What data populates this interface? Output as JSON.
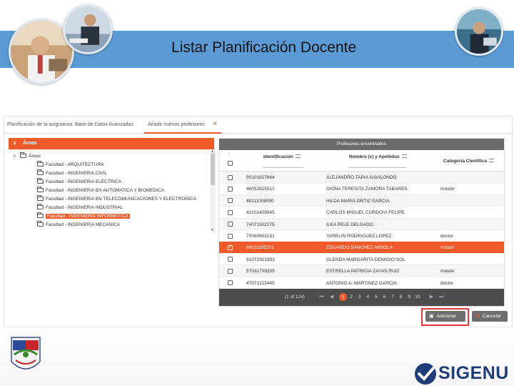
{
  "slide": {
    "title": "Listar Planificación Docente",
    "brand": "SIGENU"
  },
  "tabs": [
    {
      "label": "Planificación de la asignatura: Base de Datos Avanzadas"
    },
    {
      "label": "Añadir nuevos profesores",
      "close": "×"
    }
  ],
  "areas": {
    "header": "Áreas",
    "root": "Áreas",
    "items": [
      {
        "label": "Facultad - ARQUITECTURA",
        "selected": false
      },
      {
        "label": "Facultad - INGENIERIA CIVIL",
        "selected": false
      },
      {
        "label": "Facultad - INGENIERIA ELECTRICA",
        "selected": false
      },
      {
        "label": "Facultad - INGENIERIA EN AUTOMATICA Y BIOMEDICA",
        "selected": false
      },
      {
        "label": "Facultad - INGENIERIA EN TELECOMUNICACIONES Y ELECTRONICA",
        "selected": false
      },
      {
        "label": "Facultad - INGENIERIA INDUSTRIAL",
        "selected": false
      },
      {
        "label": "Facultad - INGENIERIA INFORMATICA",
        "selected": true
      },
      {
        "label": "Facultad - INGENIERIA MECANICA",
        "selected": false
      }
    ]
  },
  "profesores": {
    "header": "Profesores encontrados",
    "columns": {
      "id": "Identificación",
      "name": "Nombre (s) y Apellidos",
      "category": "Categoría Científica"
    },
    "rows": [
      {
        "id": "90101827864",
        "name": "ALEJANDRO TAPIA GAVILONDO",
        "category": "",
        "checked": false
      },
      {
        "id": "46052625512",
        "name": "DIONA TERESITA ZAMORA TABARES",
        "category": "master",
        "checked": false
      },
      {
        "id": "40111008000",
        "name": "HILDA MARIA ORTIZ GARCIA",
        "category": "",
        "checked": false
      },
      {
        "id": "43101409945",
        "name": "CARLOS MIGUEL CORDOVI FELIPE",
        "category": "",
        "checked": false
      },
      {
        "id": "74071502275",
        "name": "ILKA PELE DELGADO",
        "category": "",
        "checked": false
      },
      {
        "id": "70060603131",
        "name": "YARELIN RODRIGUEZ LOPEZ",
        "category": "doctor",
        "checked": false
      },
      {
        "id": "86011105201",
        "name": "EDUARDO SÁNCHEZ ANSOLA",
        "category": "master",
        "checked": true
      },
      {
        "id": "91072921933",
        "name": "GLENDA MARGARITA DEMIGIO SOL",
        "category": "",
        "checked": false
      },
      {
        "id": "57031709339",
        "name": "ESTRELLA PATRICIA ZAYAS RUIZ",
        "category": "master",
        "checked": false
      },
      {
        "id": "47071215445",
        "name": "ANTONIO A. MARTINEZ GARCIA",
        "category": "doctor",
        "checked": false
      }
    ],
    "pager": {
      "info": "(1 of 124)",
      "first": "⏮",
      "prev": "◀",
      "pages": [
        "1",
        "2",
        "3",
        "4",
        "5",
        "6",
        "7",
        "8",
        "9",
        "10"
      ],
      "active_page": "1",
      "next": "▶",
      "last": "⏭"
    }
  },
  "buttons": {
    "add": "Adicionar",
    "cancel": "Cancelar"
  },
  "colors": {
    "accent": "#ef5a2a",
    "band": "#5b9bd5",
    "brand": "#1f3d7a"
  }
}
